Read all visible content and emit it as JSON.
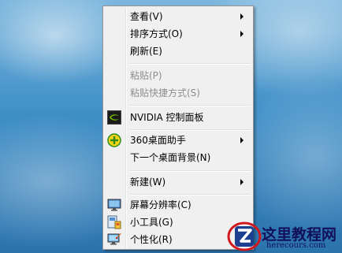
{
  "menu": {
    "items": [
      {
        "label": "查看(V)",
        "submenu": true
      },
      {
        "label": "排序方式(O)",
        "submenu": true
      },
      {
        "label": "刷新(E)"
      },
      {
        "label": "粘贴(P)",
        "disabled": true
      },
      {
        "label": "粘贴快捷方式(S)",
        "disabled": true
      },
      {
        "label": "NVIDIA 控制面板",
        "icon": "nvidia-icon"
      },
      {
        "label": "360桌面助手",
        "icon": "360-assistant-icon",
        "submenu": true
      },
      {
        "label": "下一个桌面背景(N)"
      },
      {
        "label": "新建(W)",
        "submenu": true
      },
      {
        "label": "屏幕分辨率(C)",
        "icon": "screen-resolution-icon"
      },
      {
        "label": "小工具(G)",
        "icon": "gadgets-icon"
      },
      {
        "label": "个性化(R)",
        "icon": "personalize-icon"
      }
    ]
  },
  "watermark": {
    "title": "这里教程网",
    "url": "herecours.com"
  },
  "colors": {
    "menu_background": "#f0f0f0",
    "menu_border": "#979797",
    "disabled_text": "#8d8d8d",
    "watermark_text": "#11115a"
  }
}
